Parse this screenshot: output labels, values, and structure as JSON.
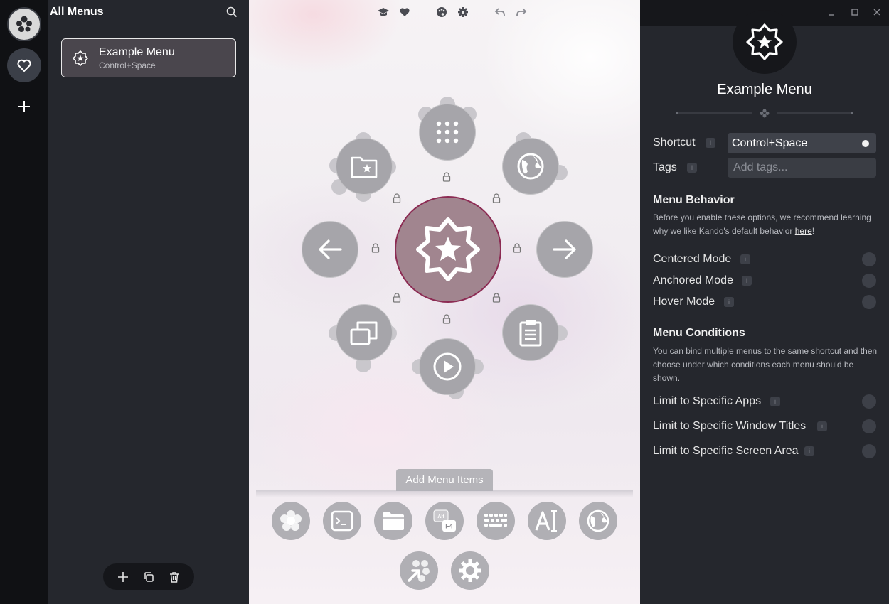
{
  "menus_panel": {
    "title": "All Menus",
    "menus": [
      {
        "name": "Example Menu",
        "shortcut": "Control+Space"
      }
    ]
  },
  "preview": {
    "add_items_label": "Add Menu Items"
  },
  "properties": {
    "menu_name": "Example Menu",
    "shortcut_label": "Shortcut",
    "shortcut_value": "Control+Space",
    "tags_label": "Tags",
    "tags_placeholder": "Add tags...",
    "behavior": {
      "title": "Menu Behavior",
      "desc_before": "Before you enable these options, we recommend learning why we like Kando's default behavior ",
      "desc_link": "here",
      "desc_after": "!",
      "options": [
        "Centered Mode",
        "Anchored Mode",
        "Hover Mode"
      ]
    },
    "conditions": {
      "title": "Menu Conditions",
      "desc": "You can bind multiple menus to the same shortcut and then choose under which conditions each menu should be shown.",
      "options": [
        "Limit to Specific Apps",
        "Limit to Specific Window Titles",
        "Limit to Specific Screen Area"
      ]
    }
  },
  "colors": {
    "accent_ring": "#8c2b53",
    "center_fill": "#a1858f",
    "panel_bg": "#25272d",
    "rail_bg": "#101114"
  }
}
